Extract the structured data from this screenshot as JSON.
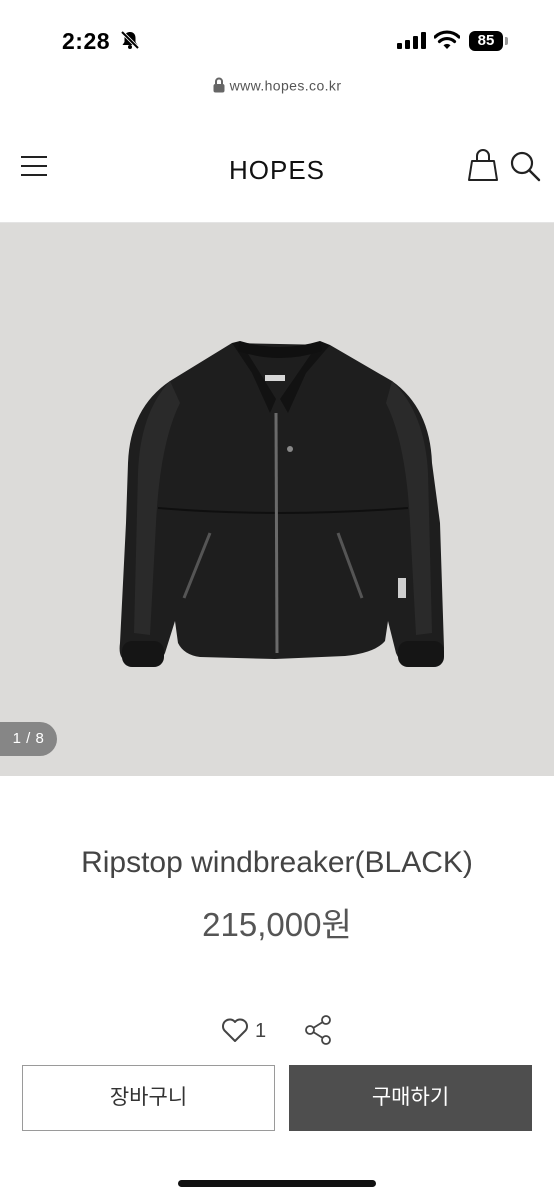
{
  "status_bar": {
    "time": "2:28",
    "battery": "85",
    "icons": [
      "bell-slash-icon",
      "signal-icon",
      "wifi-icon",
      "battery-icon"
    ]
  },
  "browser": {
    "url": "www.hopes.co.kr"
  },
  "header": {
    "logo": "HOPES",
    "icons": [
      "hamburger-menu-icon",
      "shopping-bag-icon",
      "search-icon"
    ]
  },
  "gallery": {
    "counter": "1 / 8",
    "image": "black-windbreaker-jacket-photo"
  },
  "product": {
    "name": "Ripstop windbreaker(BLACK)",
    "price": "215,000원"
  },
  "actions": {
    "like_count": "1"
  },
  "purchase": {
    "cart_label": "장바구니",
    "buy_label": "구매하기"
  },
  "colors": {
    "gallery_bg": "#dcdbd9",
    "buy_button": "#4e4e4e",
    "text": "#444444"
  }
}
